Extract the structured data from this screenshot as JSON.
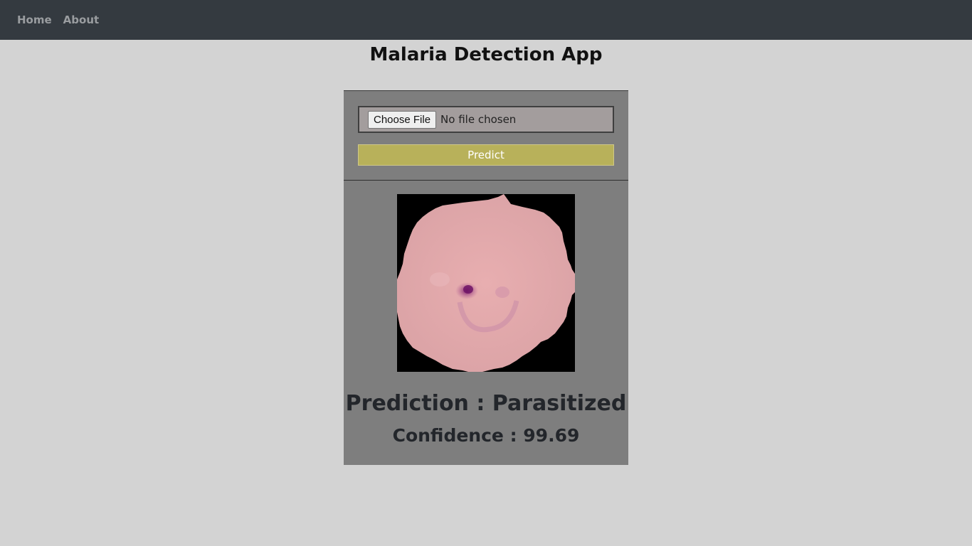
{
  "nav": {
    "items": [
      {
        "label": "Home"
      },
      {
        "label": "About"
      }
    ]
  },
  "page": {
    "title": "Malaria Detection App"
  },
  "upload": {
    "button_label": "Choose File",
    "status_text": "No file chosen"
  },
  "predict": {
    "button_label": "Predict"
  },
  "result": {
    "prediction_text": "Prediction : Parasitized",
    "confidence_text": "Confidence : 99.69"
  },
  "colors": {
    "navbar": "#343a40",
    "background": "#d3d3d3",
    "card": "#7e7e7e",
    "predict_button": "#b8b15a"
  }
}
